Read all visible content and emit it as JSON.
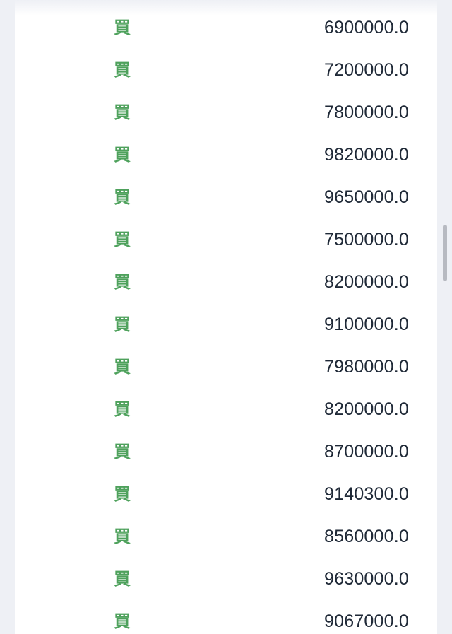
{
  "orders": {
    "rows": [
      {
        "side": "買",
        "price": "6900000.0"
      },
      {
        "side": "買",
        "price": "7200000.0"
      },
      {
        "side": "買",
        "price": "7800000.0"
      },
      {
        "side": "買",
        "price": "9820000.0"
      },
      {
        "side": "買",
        "price": "9650000.0"
      },
      {
        "side": "買",
        "price": "7500000.0"
      },
      {
        "side": "買",
        "price": "8200000.0"
      },
      {
        "side": "買",
        "price": "9100000.0"
      },
      {
        "side": "買",
        "price": "7980000.0"
      },
      {
        "side": "買",
        "price": "8200000.0"
      },
      {
        "side": "買",
        "price": "8700000.0"
      },
      {
        "side": "買",
        "price": "9140300.0"
      },
      {
        "side": "買",
        "price": "8560000.0"
      },
      {
        "side": "買",
        "price": "9630000.0"
      },
      {
        "side": "買",
        "price": "9067000.0"
      }
    ]
  },
  "colors": {
    "buy": "#4ea15c",
    "price_text": "#1f2937",
    "background": "#eef0f5",
    "panel": "#ffffff",
    "scrollbar": "#b7bac1"
  }
}
